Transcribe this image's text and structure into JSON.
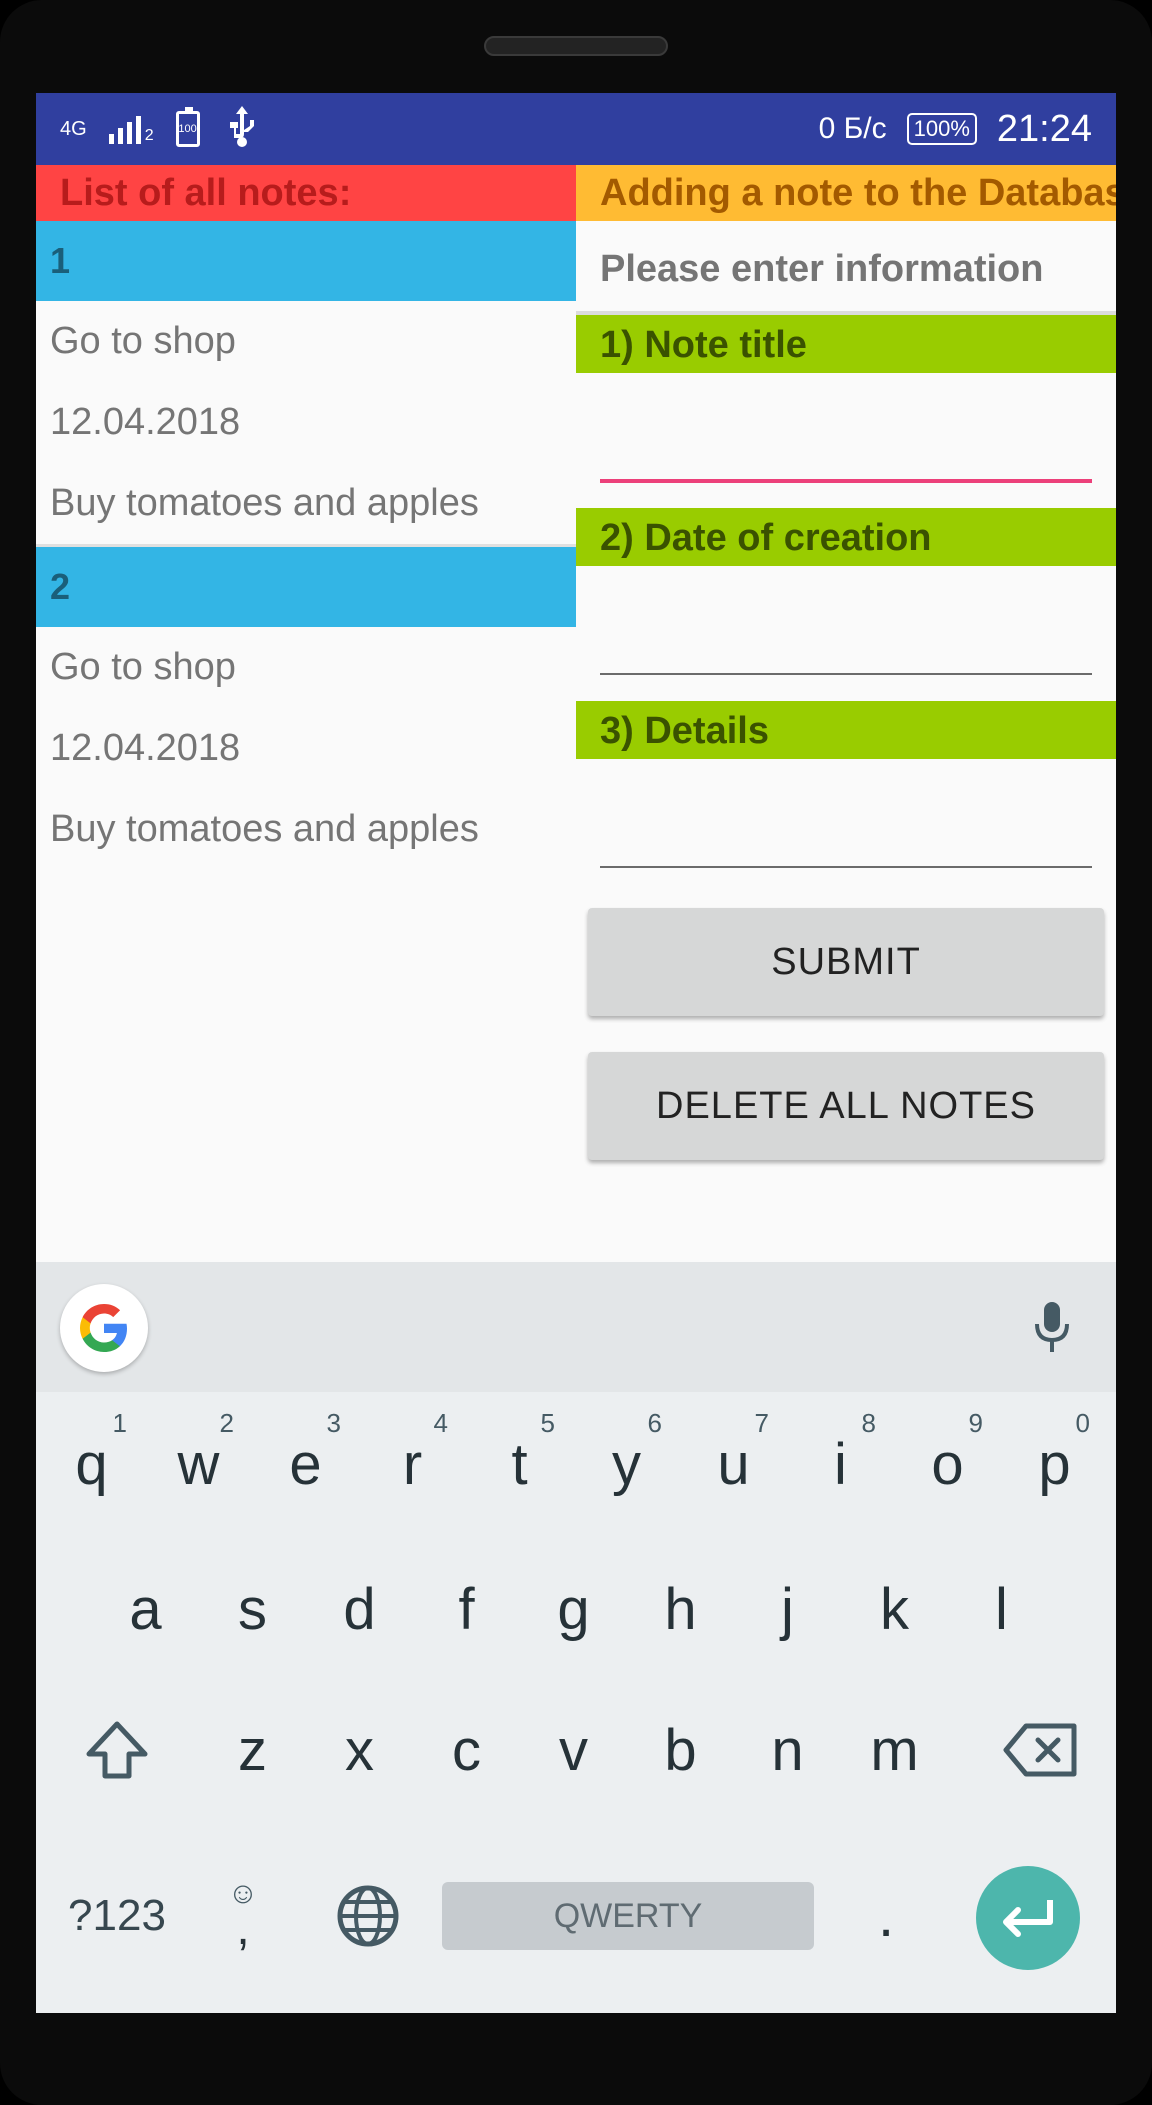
{
  "status_bar": {
    "network": "4G",
    "sim_slot": "2",
    "battery_icon_text": "100",
    "speed": "0 Б/с",
    "battery_percent": "100%",
    "time": "21:24"
  },
  "left_panel": {
    "header": "List of all notes:",
    "notes": [
      {
        "id": "1",
        "title": "Go to shop",
        "date": "12.04.2018",
        "details": "Buy tomatoes and apples"
      },
      {
        "id": "2",
        "title": "Go to shop",
        "date": "12.04.2018",
        "details": "Buy tomatoes and apples"
      }
    ]
  },
  "right_panel": {
    "header": "Adding a note to the Database",
    "prompt": "Please enter information",
    "fields": [
      {
        "label": "1) Note title",
        "value": ""
      },
      {
        "label": "2) Date of creation",
        "value": ""
      },
      {
        "label": "3) Details",
        "value": ""
      }
    ],
    "submit_label": "SUBMIT",
    "delete_label": "DELETE ALL NOTES"
  },
  "keyboard": {
    "row1": [
      {
        "key": "q",
        "hint": "1"
      },
      {
        "key": "w",
        "hint": "2"
      },
      {
        "key": "e",
        "hint": "3"
      },
      {
        "key": "r",
        "hint": "4"
      },
      {
        "key": "t",
        "hint": "5"
      },
      {
        "key": "y",
        "hint": "6"
      },
      {
        "key": "u",
        "hint": "7"
      },
      {
        "key": "i",
        "hint": "8"
      },
      {
        "key": "o",
        "hint": "9"
      },
      {
        "key": "p",
        "hint": "0"
      }
    ],
    "row2": [
      "a",
      "s",
      "d",
      "f",
      "g",
      "h",
      "j",
      "k",
      "l"
    ],
    "row3": [
      "z",
      "x",
      "c",
      "v",
      "b",
      "n",
      "m"
    ],
    "symbols_label": "?123",
    "comma": ",",
    "emoji": "☺",
    "space_label": "QWERTY",
    "period": ".",
    "accent": "#4db6ac"
  }
}
